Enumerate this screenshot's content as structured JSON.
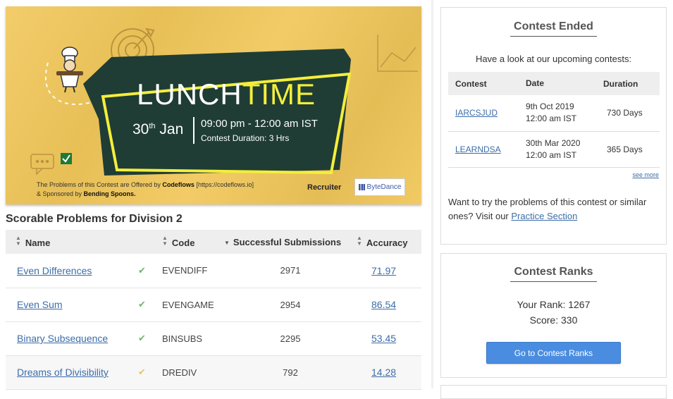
{
  "banner": {
    "title_part1": "LUNCH",
    "title_part2": "TIME",
    "date_day": "30",
    "date_suffix": "th",
    "date_month": "Jan",
    "time": "09:00 pm - 12:00 am IST",
    "duration": "Contest Duration: 3 Hrs",
    "footer_line1_prefix": "The Problems of this Contest are Offered by ",
    "footer_line1_brand": "Codeflows",
    "footer_line1_suffix": " [https://codeflows.io]",
    "footer_line2_prefix": "& Sponsored by ",
    "footer_line2_brand": "Bending Spoons.",
    "recruiter_label": "Recruiter",
    "recruiter_name": "ByteDance",
    "colors": {
      "background": "#f1c75a",
      "board": "#1f3d35",
      "highlight": "#f4ee3b"
    }
  },
  "problems": {
    "section_title": "Scorable Problems for Division 2",
    "columns": {
      "name": "Name",
      "code": "Code",
      "submissions": "Successful Submissions",
      "accuracy": "Accuracy"
    },
    "rows": [
      {
        "name": "Even Differences",
        "status_icon": "check-icon",
        "status_color": "#6cb96c",
        "code": "EVENDIFF",
        "submissions": "2971",
        "accuracy": "71.97"
      },
      {
        "name": "Even Sum",
        "status_icon": "check-icon",
        "status_color": "#6cb96c",
        "code": "EVENGAME",
        "submissions": "2954",
        "accuracy": "86.54"
      },
      {
        "name": "Binary Subsequence",
        "status_icon": "check-icon",
        "status_color": "#6cb96c",
        "code": "BINSUBS",
        "submissions": "2295",
        "accuracy": "53.45"
      },
      {
        "name": "Dreams of Divisibility",
        "status_icon": "check-icon",
        "status_color": "#e8c56a",
        "code": "DREDIV",
        "submissions": "792",
        "accuracy": "14.28"
      }
    ]
  },
  "contest_ended": {
    "title": "Contest Ended",
    "upcoming_note": "Have a look at our upcoming contests:",
    "columns": {
      "contest": "Contest",
      "date": "Date",
      "duration": "Duration"
    },
    "rows": [
      {
        "contest": "IARCSJUD",
        "date_line1": "9th Oct 2019",
        "date_line2": "12:00 am IST",
        "duration": "730 Days"
      },
      {
        "contest": "LEARNDSA",
        "date_line1": "30th Mar 2020",
        "date_line2": "12:00 am IST",
        "duration": "365 Days"
      }
    ],
    "see_more": "see more",
    "practice_text": "Want to try the problems of this contest or similar ones? Visit our ",
    "practice_link": "Practice Section"
  },
  "contest_ranks": {
    "title": "Contest Ranks",
    "rank_text": "Your Rank: 1267",
    "score_text": "Score: 330",
    "button_label": "Go to Contest Ranks"
  }
}
